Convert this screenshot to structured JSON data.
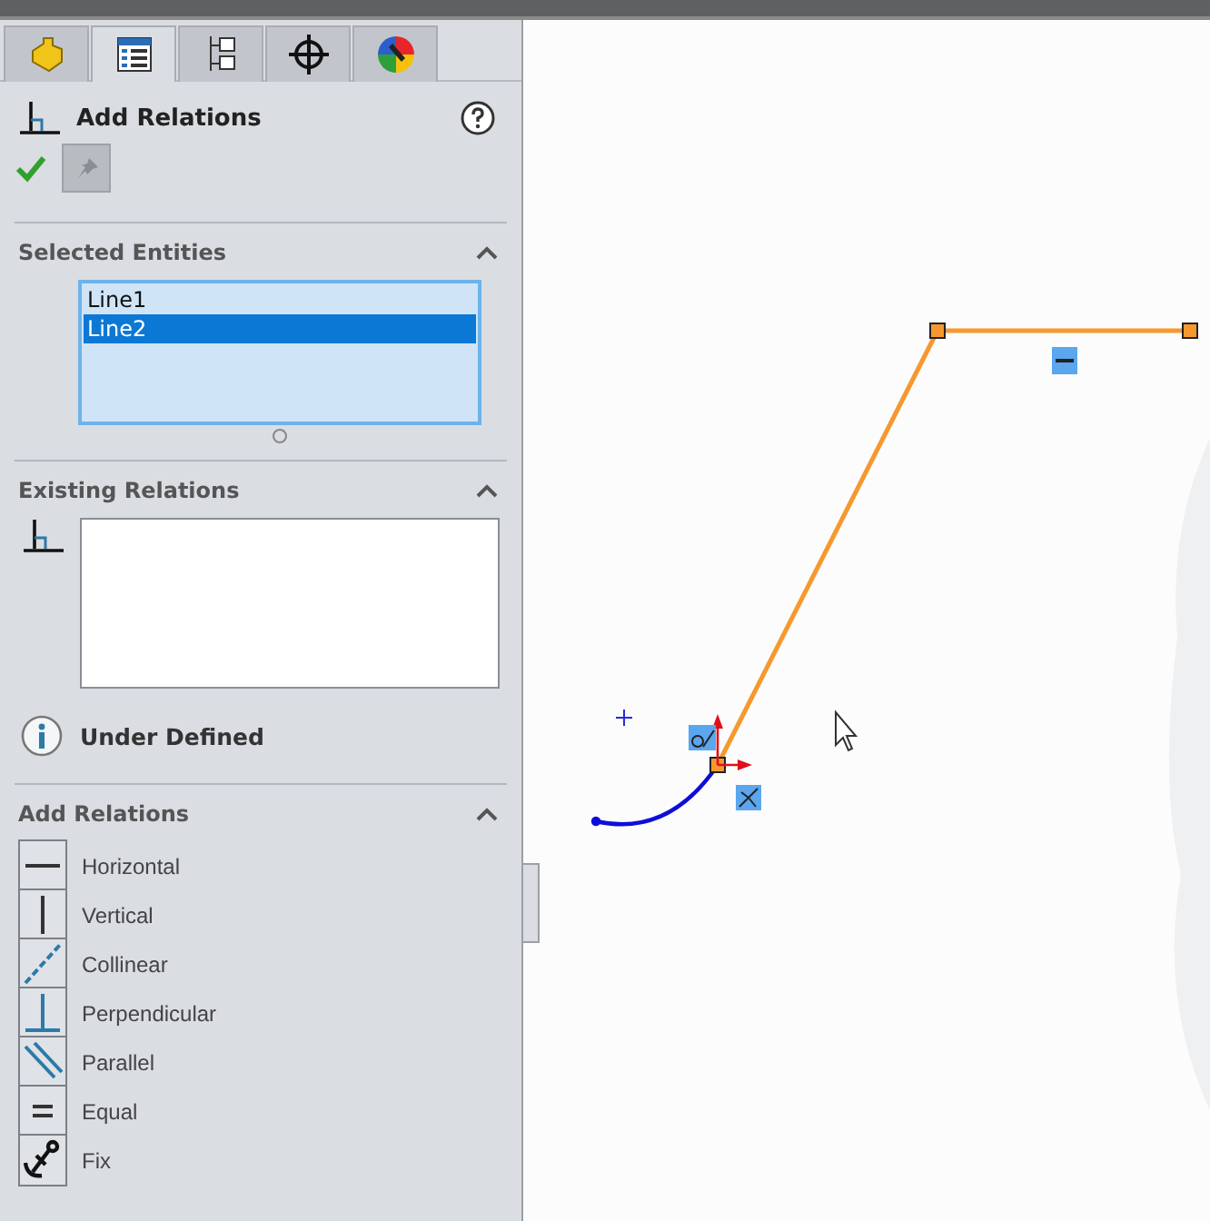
{
  "tabs": [
    {
      "kind": "part",
      "selected": false
    },
    {
      "kind": "property",
      "selected": true
    },
    {
      "kind": "config",
      "selected": false
    },
    {
      "kind": "target",
      "selected": false
    },
    {
      "kind": "appearance",
      "selected": false
    }
  ],
  "property_manager": {
    "title": "Add Relations"
  },
  "sections": [
    {
      "kind": "entities",
      "title": "Selected Entities",
      "expanded": true,
      "items": [
        {
          "label": "Line1",
          "selected": false
        },
        {
          "label": "Line2",
          "selected": true
        }
      ]
    },
    {
      "kind": "existing",
      "title": "Existing Relations",
      "expanded": true,
      "status": "Under Defined"
    },
    {
      "kind": "add",
      "title": "Add Relations",
      "expanded": true,
      "items": [
        {
          "kind": "horizontal",
          "label": "Horizontal"
        },
        {
          "kind": "vertical",
          "label": "Vertical"
        },
        {
          "kind": "collinear",
          "label": "Collinear"
        },
        {
          "kind": "perpendicular",
          "label": "Perpendicular"
        },
        {
          "kind": "parallel",
          "label": "Parallel"
        },
        {
          "kind": "equal",
          "label": "Equal"
        },
        {
          "kind": "fix",
          "label": "Fix"
        }
      ]
    }
  ]
}
